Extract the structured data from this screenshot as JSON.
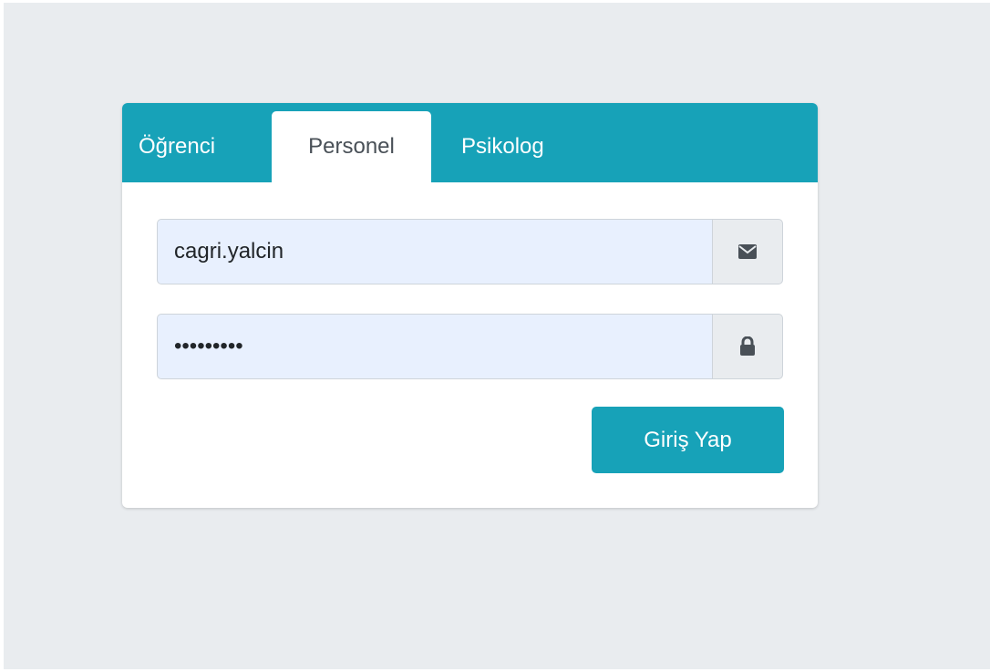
{
  "tabs": [
    {
      "label": "Öğrenci",
      "active": false
    },
    {
      "label": "Personel",
      "active": true
    },
    {
      "label": "Psikolog",
      "active": false
    }
  ],
  "username": {
    "value": "cagri.yalcin",
    "icon": "envelope-icon"
  },
  "password": {
    "value": "123456789",
    "icon": "lock-icon"
  },
  "submit": {
    "label": "Giriş Yap"
  },
  "colors": {
    "accent": "#17a2b8",
    "page_background": "#e9ecef",
    "input_fill": "#e8f0fe"
  }
}
